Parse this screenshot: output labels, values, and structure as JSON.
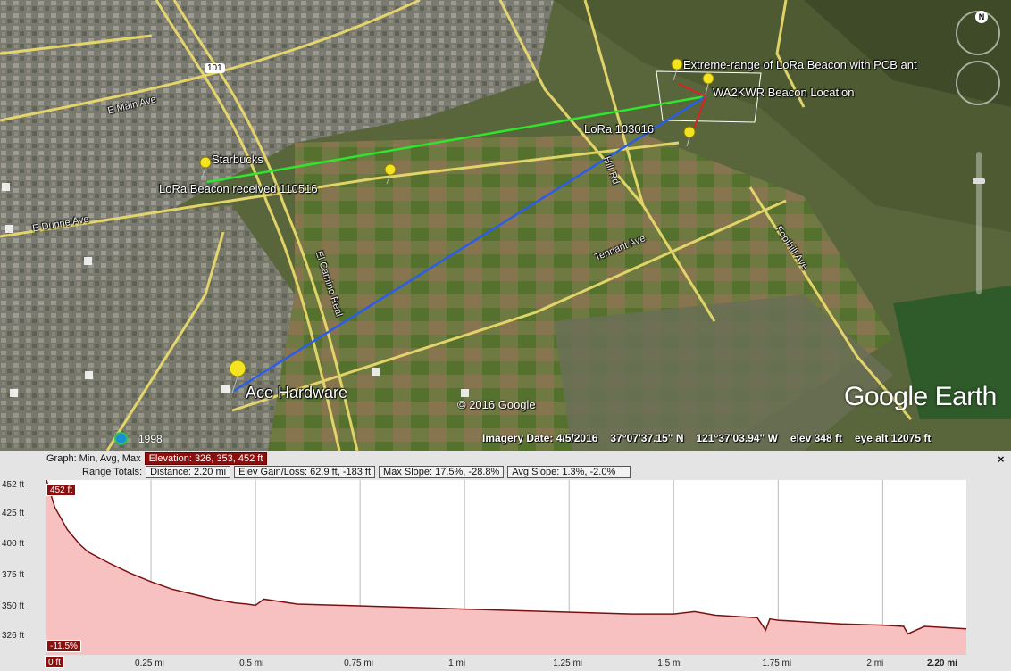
{
  "map": {
    "placemarks": [
      {
        "name": "extreme",
        "label": "Extreme-range of LoRa Beacon with PCB ant"
      },
      {
        "name": "wa2kwr",
        "label": "WA2KWR Beacon Location"
      },
      {
        "name": "lora103016",
        "label": "LoRa 103016"
      },
      {
        "name": "starbucks",
        "label": "Starbucks"
      },
      {
        "name": "lora110516",
        "label": "LoRa Beacon received 110516"
      },
      {
        "name": "ace",
        "label": "Ace Hardware"
      }
    ],
    "roads": {
      "e_main": "E Main Ave",
      "e_dunne": "E Dunne Ave",
      "el_camino": "El Camino Real",
      "hill_rd": "Hill Rd",
      "tennant": "Tennant Ave",
      "foothill": "Foothill Ave",
      "hwy": "101"
    },
    "copyright": "© 2016 Google",
    "logo": "Google Earth",
    "historical_year": "1998",
    "status": {
      "imagery_date": "Imagery Date: 4/5/2016",
      "lat": "37°07'37.15\" N",
      "lon": "121°37'03.94\" W",
      "elev": "elev   348 ft",
      "eye_alt": "eye alt  12075 ft"
    },
    "compass_letter": "N"
  },
  "profile": {
    "graph_label": "Graph: Min, Avg, Max",
    "elevation": "Elevation: 326, 353, 452 ft",
    "range_totals_label": "Range Totals:",
    "distance": "Distance: 2.20 mi",
    "elev_gain_loss": "Elev Gain/Loss: 62.9 ft, -183 ft",
    "max_slope": "Max Slope: 17.5%, -28.8%",
    "avg_slope": "Avg Slope: 1.3%, -2.0%",
    "close": "×",
    "max_tag": "452 ft",
    "slope_tag": "-11.5%",
    "start_tag": "0 ft",
    "end_label": "2.20 mi"
  },
  "chart_data": {
    "type": "area",
    "xlabel": "",
    "ylabel": "",
    "x_unit": "mi",
    "y_unit": "ft",
    "xlim": [
      0,
      2.2
    ],
    "ylim": [
      311,
      452
    ],
    "y_ticks": [
      {
        "value": 452,
        "label": "452 ft"
      },
      {
        "value": 425,
        "label": "425 ft"
      },
      {
        "value": 400,
        "label": "400 ft"
      },
      {
        "value": 375,
        "label": "375 ft"
      },
      {
        "value": 350,
        "label": "350 ft"
      },
      {
        "value": 326,
        "label": "326 ft"
      }
    ],
    "x_ticks": [
      {
        "value": 0.25,
        "label": "0.25 mi"
      },
      {
        "value": 0.5,
        "label": "0.5 mi"
      },
      {
        "value": 0.75,
        "label": "0.75 mi"
      },
      {
        "value": 1.0,
        "label": "1 mi"
      },
      {
        "value": 1.25,
        "label": "1.25 mi"
      },
      {
        "value": 1.5,
        "label": "1.5 mi"
      },
      {
        "value": 1.75,
        "label": "1.75 mi"
      },
      {
        "value": 2.0,
        "label": "2 mi"
      }
    ],
    "series": [
      {
        "x": [
          0,
          0.02,
          0.05,
          0.08,
          0.1,
          0.15,
          0.2,
          0.25,
          0.3,
          0.35,
          0.4,
          0.45,
          0.48,
          0.5,
          0.52,
          0.6,
          0.7,
          0.8,
          0.9,
          1.0,
          1.1,
          1.2,
          1.3,
          1.4,
          1.5,
          1.55,
          1.6,
          1.7,
          1.72,
          1.73,
          1.75,
          1.8,
          1.9,
          2.0,
          2.05,
          2.06,
          2.1,
          2.15,
          2.2
        ],
        "y": [
          452,
          430,
          412,
          400,
          394,
          385,
          377,
          370,
          364,
          360,
          356,
          353,
          352,
          351,
          356,
          352,
          351,
          350,
          349,
          348,
          347,
          346,
          345,
          344,
          344,
          346,
          343,
          341,
          331,
          340,
          339,
          338,
          336,
          335,
          334,
          328,
          334,
          333,
          332
        ]
      }
    ],
    "grid": true
  }
}
